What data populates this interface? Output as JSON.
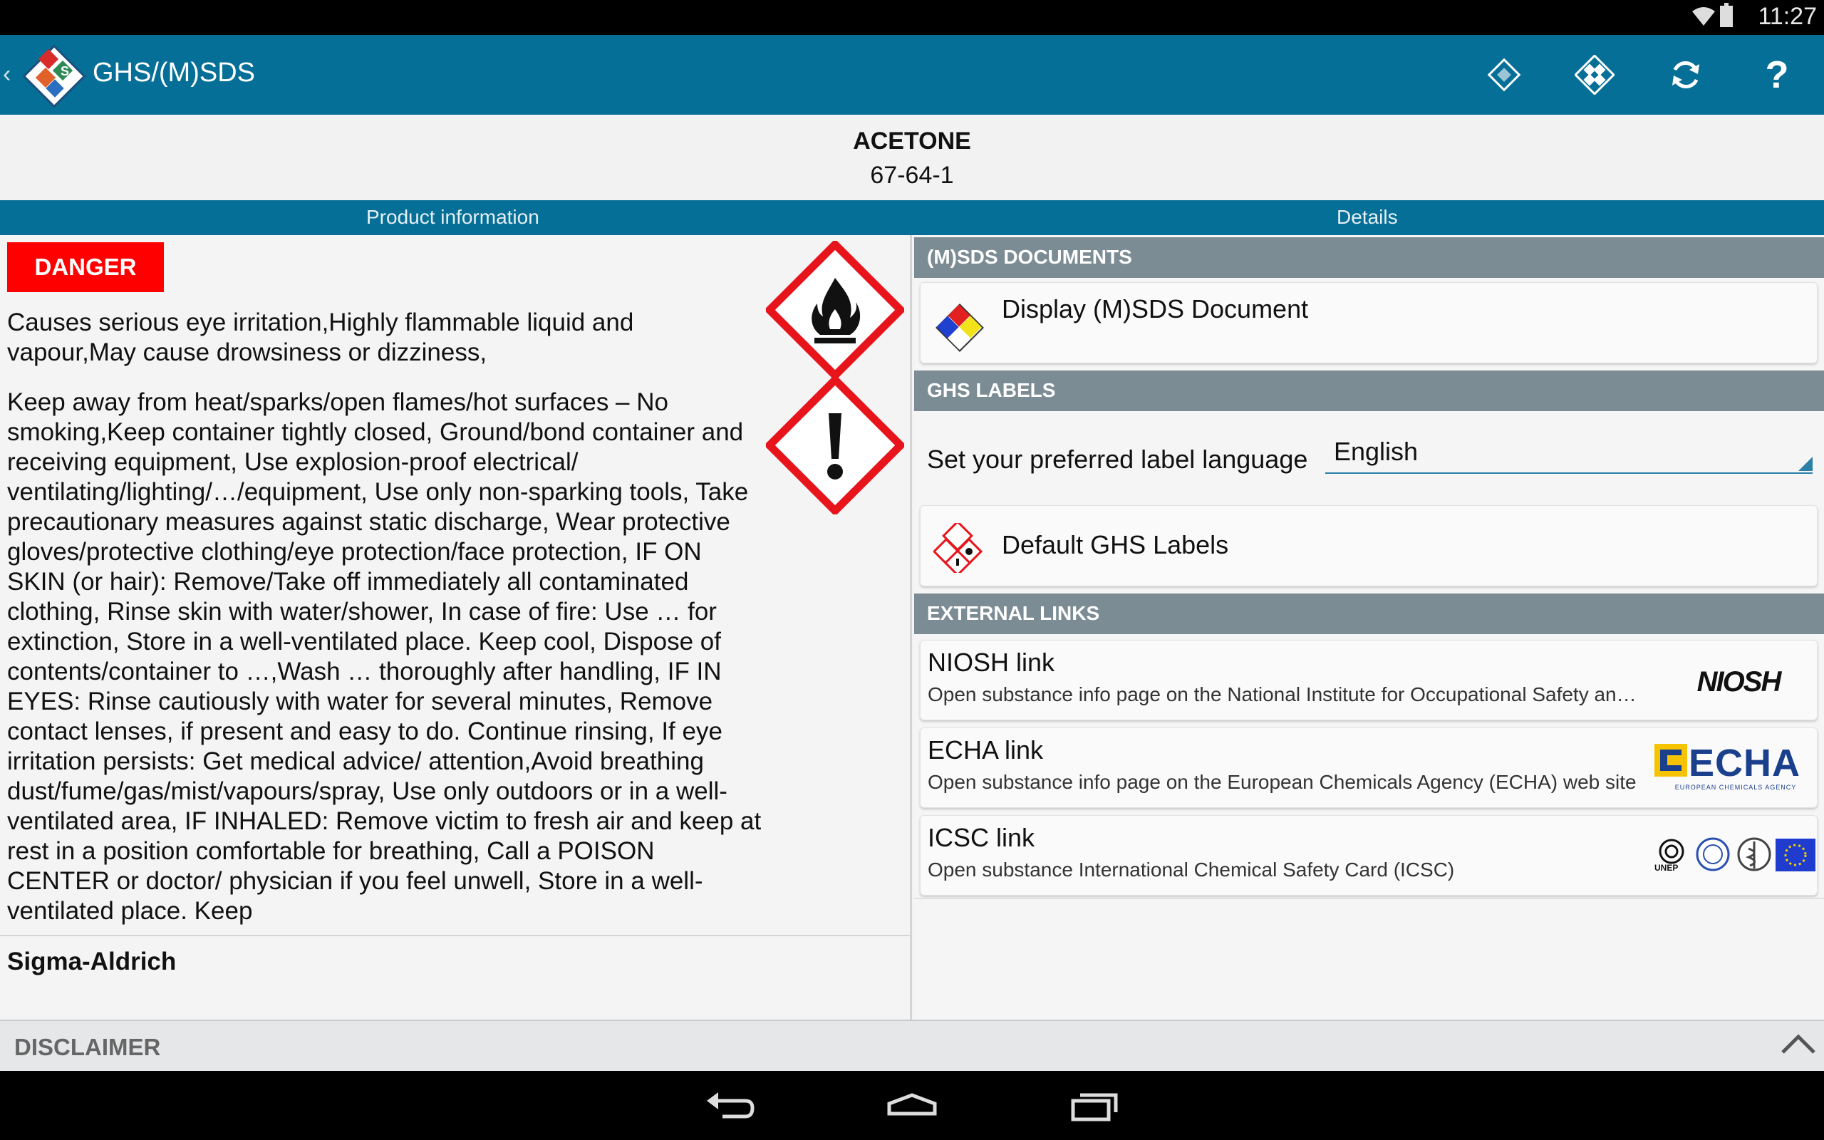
{
  "status_bar": {
    "time": "11:27"
  },
  "app_bar": {
    "title": "GHS/(M)SDS"
  },
  "product": {
    "name": "ACETONE",
    "cas": "67-64-1"
  },
  "tabs": [
    {
      "label": "Product information"
    },
    {
      "label": "Details"
    }
  ],
  "product_info": {
    "signal_word": "DANGER",
    "hazard_statements": "Causes serious eye irritation,Highly flammable liquid and vapour,May cause drowsiness or dizziness,",
    "precautionary_statements": "Keep away from heat/sparks/open flames/hot surfaces – No smoking,Keep container tightly closed, Ground/bond container and receiving equipment, Use explosion-proof electrical/ ventilating/lighting/…/equipment, Use only non-sparking tools, Take precautionary measures against static discharge, Wear protective gloves/protective clothing/eye protection/face protection, IF ON SKIN (or hair): Remove/Take off immediately all contaminated clothing, Rinse skin with water/shower, In case of fire: Use … for extinction, Store in a well-ventilated place. Keep cool, Dispose of contents/container to …,Wash … thoroughly after handling, IF IN EYES: Rinse cautiously with water for several minutes, Remove contact lenses, if present and easy to do. Continue rinsing, If eye irritation persists: Get medical advice/ attention,Avoid breathing dust/fume/gas/mist/vapours/spray, Use only outdoors or in a well-ventilated area, IF INHALED: Remove victim to fresh air and keep at rest in a position comfortable for breathing, Call a POISON CENTER or doctor/ physician if you feel unwell, Store in a well-ventilated place. Keep",
    "supplier": "Sigma-Aldrich",
    "pictograms": [
      "flame-icon",
      "exclamation-mark-icon"
    ]
  },
  "details": {
    "msds_section": "(M)SDS DOCUMENTS",
    "display_msds": "Display (M)SDS Document",
    "ghs_section": "GHS LABELS",
    "language_label": "Set your preferred label language",
    "language_value": "English",
    "default_labels": "Default GHS Labels",
    "links_section": "EXTERNAL LINKS",
    "links": [
      {
        "title": "NIOSH link",
        "desc": "Open substance info page on the National Institute for Occupational Safety an…",
        "logo": "NIOSH"
      },
      {
        "title": "ECHA link",
        "desc": "Open substance info page on the European Chemicals Agency (ECHA) web site",
        "logo": "ECHA",
        "logo_sub": "EUROPEAN CHEMICALS AGENCY"
      },
      {
        "title": "ICSC link",
        "desc": "Open substance International Chemical Safety Card (ICSC)",
        "logo": "UNEP"
      }
    ]
  },
  "disclaimer": {
    "label": "DISCLAIMER"
  },
  "colors": {
    "primary": "#066f97",
    "danger": "#ff0000",
    "section": "#7c8c94"
  }
}
